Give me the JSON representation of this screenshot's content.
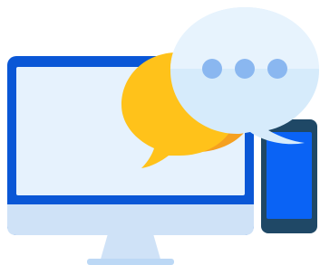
{
  "illustration": {
    "icons": [
      "desktop-monitor-icon",
      "smartphone-icon",
      "chat-bubble-icon",
      "typing-indicator-icon"
    ],
    "colors": {
      "monitor_frame": "#0a57d6",
      "monitor_screen": "#e6f2fd",
      "monitor_chin": "#cfe2f7",
      "monitor_stand": "#bcd8f5",
      "phone_body": "#1f4866",
      "phone_screen": "#0a63f5",
      "yellow_bubble": "#ffc21a",
      "orange_bubble": "#f5a020",
      "light_bubble": "#d6ebfb",
      "light_bubble_top": "#e7f3fd",
      "typing_dots": "#8ab7f0"
    }
  }
}
